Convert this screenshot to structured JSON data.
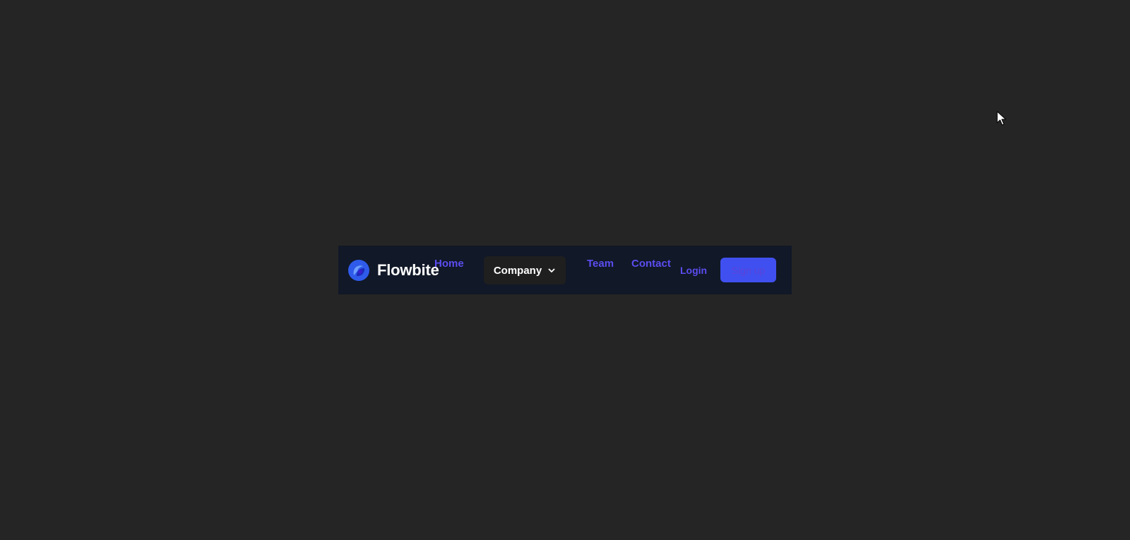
{
  "brand": {
    "name": "Flowbite",
    "logo_icon": "flowbite-logo-icon"
  },
  "nav": {
    "home": "Home",
    "company": "Company",
    "team": "Team",
    "contact": "Contact"
  },
  "auth": {
    "login": "Login",
    "signup": "Sign up"
  },
  "colors": {
    "page_background": "#252525",
    "navbar_background": "#111827",
    "link": "#5b4df0",
    "dropdown_background": "#1f1f1f",
    "signup_background": "#4050f0",
    "signup_text": "#5a43d8"
  },
  "icons": {
    "dropdown": "chevron-down-icon",
    "cursor": "mouse-pointer-icon"
  }
}
